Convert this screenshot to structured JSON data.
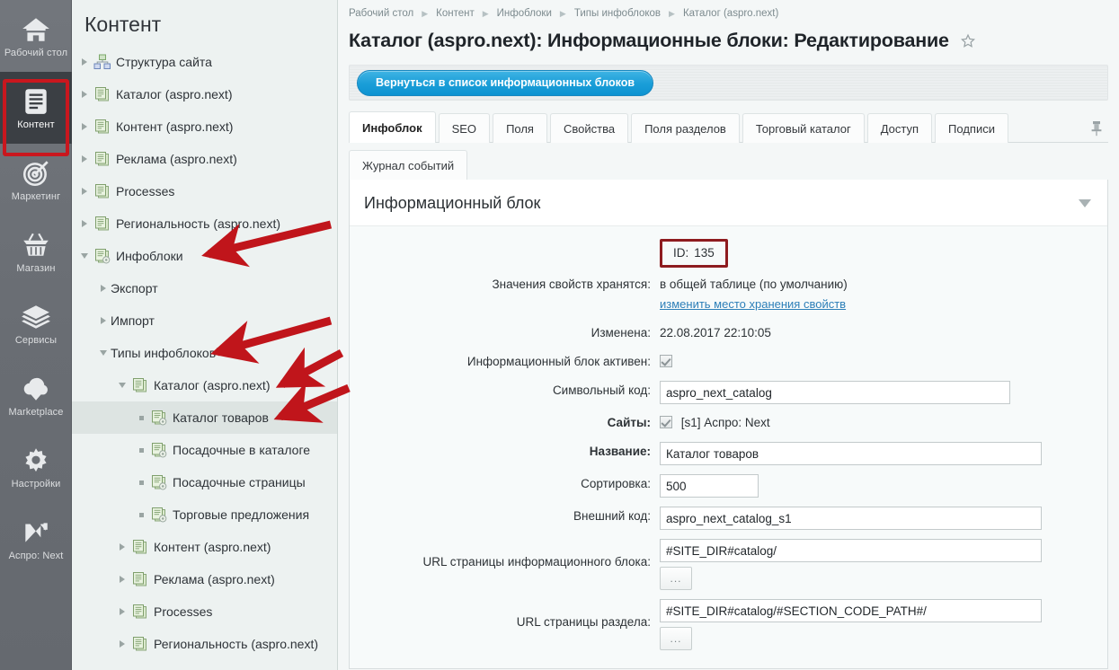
{
  "rail": {
    "items": [
      {
        "label": "Рабочий стол",
        "icon": "home-icon",
        "active": false
      },
      {
        "label": "Контент",
        "icon": "document-icon",
        "active": true
      },
      {
        "label": "Маркетинг",
        "icon": "target-icon",
        "active": false
      },
      {
        "label": "Магазин",
        "icon": "basket-icon",
        "active": false
      },
      {
        "label": "Сервисы",
        "icon": "layers-icon",
        "active": false
      },
      {
        "label": "Marketplace",
        "icon": "cloud-download-icon",
        "active": false
      },
      {
        "label": "Настройки",
        "icon": "gear-icon",
        "active": false
      },
      {
        "label": "Аспро: Next",
        "icon": "aspro-logo-icon",
        "active": false
      }
    ],
    "highlight_color": "#c9171e"
  },
  "tree": {
    "title": "Контент",
    "nodes": [
      {
        "label": "Структура сайта",
        "indent": 0,
        "twisty": "right",
        "icon": "sitemap-icon",
        "selected": false
      },
      {
        "label": "Каталог (aspro.next)",
        "indent": 0,
        "twisty": "right",
        "icon": "iblock-icon",
        "selected": false
      },
      {
        "label": "Контент (aspro.next)",
        "indent": 0,
        "twisty": "right",
        "icon": "iblock-icon",
        "selected": false
      },
      {
        "label": "Реклама (aspro.next)",
        "indent": 0,
        "twisty": "right",
        "icon": "iblock-icon",
        "selected": false
      },
      {
        "label": "Processes",
        "indent": 0,
        "twisty": "right",
        "icon": "iblock-icon",
        "selected": false
      },
      {
        "label": "Региональность (aspro.next)",
        "indent": 0,
        "twisty": "right",
        "icon": "iblock-icon",
        "selected": false
      },
      {
        "label": "Инфоблоки",
        "indent": 0,
        "twisty": "down",
        "icon": "iblock-gear-icon",
        "selected": false
      },
      {
        "label": "Экспорт",
        "indent": 1,
        "twisty": "right",
        "icon": "none",
        "selected": false
      },
      {
        "label": "Импорт",
        "indent": 1,
        "twisty": "right",
        "icon": "none",
        "selected": false
      },
      {
        "label": "Типы инфоблоков",
        "indent": 1,
        "twisty": "down",
        "icon": "none",
        "selected": false
      },
      {
        "label": "Каталог (aspro.next)",
        "indent": 2,
        "twisty": "down",
        "icon": "iblock-icon",
        "selected": false
      },
      {
        "label": "Каталог товаров",
        "indent": 3,
        "twisty": "dot",
        "icon": "iblock-gear-icon",
        "selected": true
      },
      {
        "label": "Посадочные в каталоге",
        "indent": 3,
        "twisty": "dot",
        "icon": "iblock-gear-icon",
        "selected": false
      },
      {
        "label": "Посадочные страницы",
        "indent": 3,
        "twisty": "dot",
        "icon": "iblock-gear-icon",
        "selected": false
      },
      {
        "label": "Торговые предложения",
        "indent": 3,
        "twisty": "dot",
        "icon": "iblock-gear-icon",
        "selected": false
      },
      {
        "label": "Контент (aspro.next)",
        "indent": 2,
        "twisty": "right",
        "icon": "iblock-icon",
        "selected": false
      },
      {
        "label": "Реклама (aspro.next)",
        "indent": 2,
        "twisty": "right",
        "icon": "iblock-icon",
        "selected": false
      },
      {
        "label": "Processes",
        "indent": 2,
        "twisty": "right",
        "icon": "iblock-icon",
        "selected": false
      },
      {
        "label": "Региональность (aspro.next)",
        "indent": 2,
        "twisty": "right",
        "icon": "iblock-icon",
        "selected": false
      }
    ]
  },
  "breadcrumb": [
    "Рабочий стол",
    "Контент",
    "Инфоблоки",
    "Типы инфоблоков",
    "Каталог (aspro.next)"
  ],
  "page": {
    "title": "Каталог (aspro.next): Информационные блоки: Редактирование",
    "favorite_icon": "star-icon"
  },
  "toolbar": {
    "back_label": "Вернуться в список информационных блоков"
  },
  "tabs": {
    "primary": [
      {
        "label": "Инфоблок",
        "active": true
      },
      {
        "label": "SEO",
        "active": false
      },
      {
        "label": "Поля",
        "active": false
      },
      {
        "label": "Свойства",
        "active": false
      },
      {
        "label": "Поля разделов",
        "active": false
      },
      {
        "label": "Торговый каталог",
        "active": false
      },
      {
        "label": "Доступ",
        "active": false
      },
      {
        "label": "Подписи",
        "active": false
      }
    ],
    "secondary": [
      {
        "label": "Журнал событий",
        "active": false
      }
    ],
    "pin_icon": "pushpin-icon"
  },
  "card": {
    "title": "Информационный блок",
    "collapse_icon": "chevron-down-icon",
    "fields": {
      "id_label": "ID:",
      "id_value": "135",
      "id_highlight_color": "#8e1b1f",
      "storage_label": "Значения свойств хранятся:",
      "storage_value": "в общей таблице (по умолчанию)",
      "storage_link": "изменить место хранения свойств",
      "modified_label": "Изменена:",
      "modified_value": "22.08.2017 22:10:05",
      "active_label": "Информационный блок активен:",
      "active_checked": true,
      "code_label": "Символьный код:",
      "code_value": "aspro_next_catalog",
      "sites_label": "Сайты:",
      "sites_checked": true,
      "sites_value": "[s1] Аспро: Next",
      "name_label": "Название:",
      "name_value": "Каталог товаров",
      "sort_label": "Сортировка:",
      "sort_value": "500",
      "xml_label": "Внешний код:",
      "xml_value": "aspro_next_catalog_s1",
      "iblock_url_label": "URL страницы информационного блока:",
      "iblock_url_value": "#SITE_DIR#catalog/",
      "section_url_label": "URL страницы раздела:",
      "section_url_value": "#SITE_DIR#catalog/#SECTION_CODE_PATH#/",
      "dots_label": "..."
    }
  },
  "annotations": {
    "arrow_color": "#c0151b",
    "arrows": [
      {
        "name": "arrow-to-infobloki"
      },
      {
        "name": "arrow-to-tipy-infoblokov"
      },
      {
        "name": "arrow-to-katalog-aspro-next"
      },
      {
        "name": "arrow-to-katalog-tovarov"
      }
    ]
  }
}
